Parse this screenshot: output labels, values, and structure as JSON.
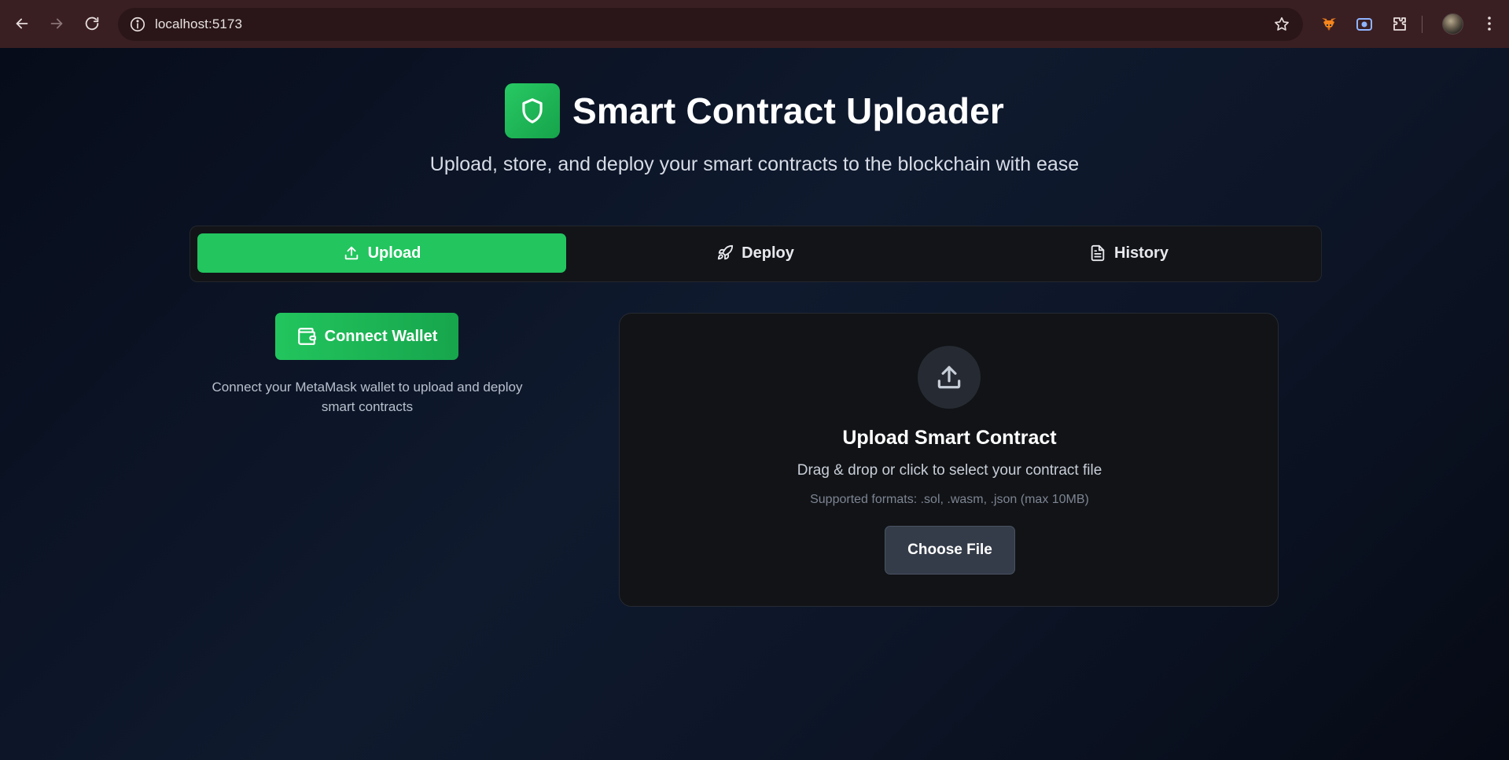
{
  "browser": {
    "url": "localhost:5173"
  },
  "header": {
    "title": "Smart Contract Uploader",
    "subtitle": "Upload, store, and deploy your smart contracts to the blockchain with ease",
    "logo_icon": "shield-icon"
  },
  "tabs": [
    {
      "label": "Upload",
      "icon": "upload-icon",
      "active": true
    },
    {
      "label": "Deploy",
      "icon": "rocket-icon",
      "active": false
    },
    {
      "label": "History",
      "icon": "file-text-icon",
      "active": false
    }
  ],
  "wallet": {
    "button_label": "Connect Wallet",
    "button_icon": "wallet-icon",
    "hint": "Connect your MetaMask wallet to upload and deploy smart contracts"
  },
  "upload": {
    "title": "Upload Smart Contract",
    "description": "Drag & drop or click to select your contract file",
    "formats": "Supported formats: .sol, .wasm, .json (max 10MB)",
    "button_label": "Choose File"
  },
  "colors": {
    "accent": "#22c55e",
    "background": "#0a1020",
    "card": "#111316",
    "chrome": "#3a1f22"
  }
}
